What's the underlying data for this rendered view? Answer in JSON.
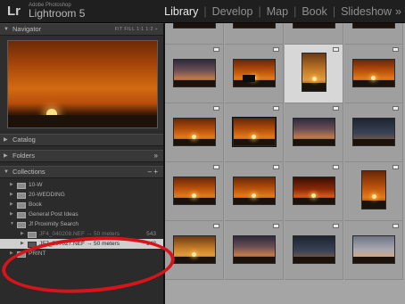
{
  "app": {
    "vendor": "Adobe Photoshop",
    "name": "Lightroom 5",
    "logo": "Lr"
  },
  "modules": [
    {
      "label": "Library",
      "active": true
    },
    {
      "label": "Develop",
      "active": false
    },
    {
      "label": "Map",
      "active": false
    },
    {
      "label": "Book",
      "active": false
    },
    {
      "label": "Slideshow",
      "active": false
    }
  ],
  "modules_more": "»",
  "navigator": {
    "title": "Navigator",
    "zoom_options": "FIT  FILL  1:1  1:2 ÷"
  },
  "panels": {
    "catalog": "Catalog",
    "folders": "Folders",
    "folders_action": "»",
    "collections": "Collections",
    "collections_actions": "–  +"
  },
  "collections": [
    {
      "label": "10-W",
      "count": "",
      "level": 0,
      "selected": false
    },
    {
      "label": "20-WEDDING",
      "count": "",
      "level": 0,
      "selected": false
    },
    {
      "label": "Book",
      "count": "",
      "level": 0,
      "selected": false
    },
    {
      "label": "General Post Ideas",
      "count": "",
      "level": 0,
      "selected": false
    },
    {
      "label": "Jf Proximity Search",
      "count": "",
      "level": 0,
      "selected": false
    },
    {
      "label": "JF4_040208.NEF → 50 meters",
      "count": "543",
      "level": 1,
      "selected": false
    },
    {
      "label": "JF7_007027.NEF → 50 meters",
      "count": "548",
      "level": 1,
      "selected": true
    },
    {
      "label": "PRINT",
      "count": "",
      "level": 0,
      "selected": false
    }
  ],
  "grid": {
    "selected_index": 6,
    "thumbnails": [
      {
        "style": "dark"
      },
      {
        "style": "dark"
      },
      {
        "style": "dark"
      },
      {
        "style": "dark"
      },
      {
        "style": "dusk"
      },
      {
        "style": "fire"
      },
      {
        "style": "gold"
      },
      {
        "style": "fire"
      },
      {
        "style": "fire"
      },
      {
        "style": "fire"
      },
      {
        "style": "dusk"
      },
      {
        "style": "dark"
      },
      {
        "style": "fire"
      },
      {
        "style": "fire"
      },
      {
        "style": "red"
      },
      {
        "style": "fire"
      },
      {
        "style": "gold"
      },
      {
        "style": "dusk"
      },
      {
        "style": "dark"
      },
      {
        "style": "pale"
      }
    ]
  },
  "colors": {
    "annotation": "#d7141a",
    "selected_row": "#cfcfcf",
    "grid_bg": "#a5a5a5"
  }
}
